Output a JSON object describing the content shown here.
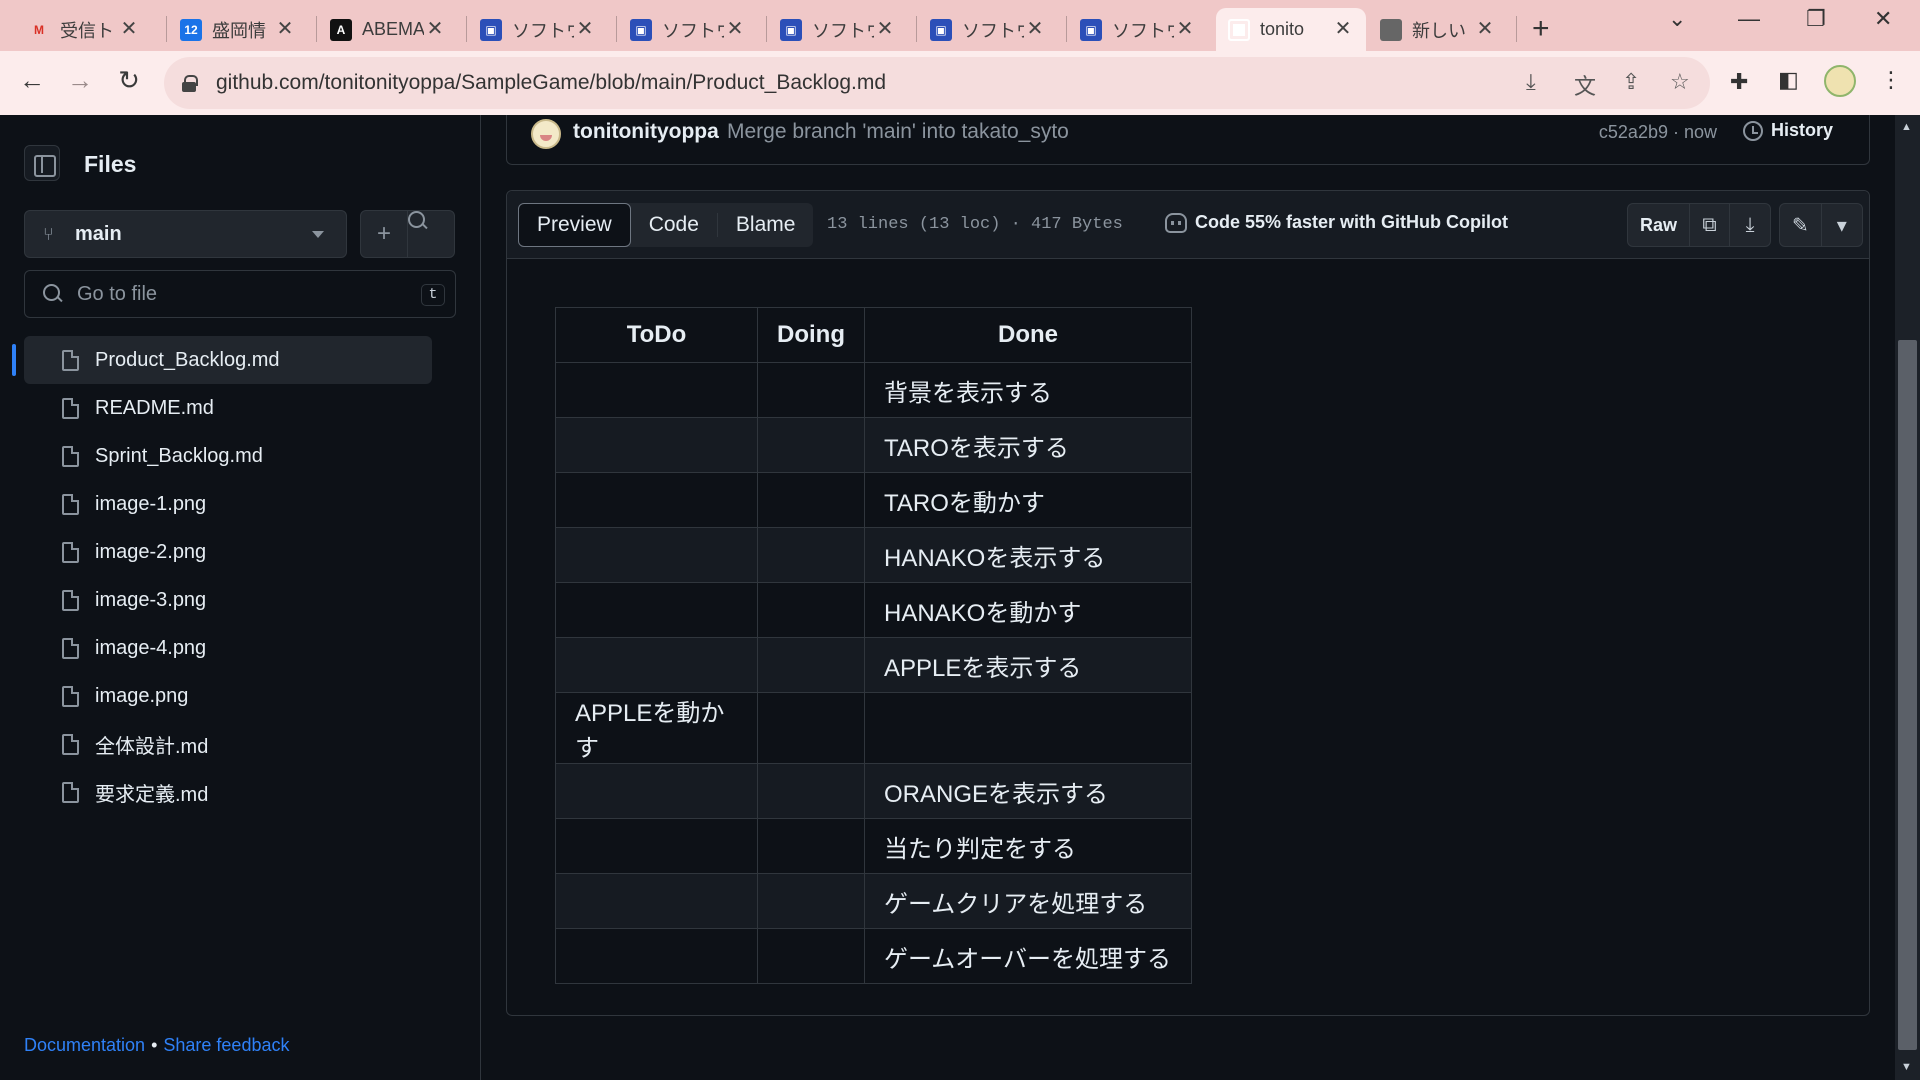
{
  "browser": {
    "tabs": [
      {
        "title": "受信ト",
        "favicon": "gmail-icon",
        "glyph": "M"
      },
      {
        "title": "盛岡情",
        "favicon": "calendar-icon",
        "glyph": "12"
      },
      {
        "title": "ABEMA",
        "favicon": "abema-icon",
        "glyph": "A"
      },
      {
        "title": "ソフトウ",
        "favicon": "app-icon",
        "glyph": "▣"
      },
      {
        "title": "ソフトウ",
        "favicon": "app-icon",
        "glyph": "▣"
      },
      {
        "title": "ソフトウ",
        "favicon": "app-icon",
        "glyph": "▣"
      },
      {
        "title": "ソフトウ",
        "favicon": "app-icon",
        "glyph": "▣"
      },
      {
        "title": "ソフトウ",
        "favicon": "app-icon",
        "glyph": "▣"
      },
      {
        "title": "tonito",
        "favicon": "github-icon",
        "glyph": ""
      },
      {
        "title": "新しい",
        "favicon": "chrome-icon",
        "glyph": ""
      }
    ],
    "close_glyph": "✕",
    "new_tab_glyph": "+",
    "url": "github.com/tonitonityoppa/SampleGame/blob/main/Product_Backlog.md"
  },
  "sidebar": {
    "title": "Files",
    "branch": "main",
    "add_glyph": "+",
    "search_glyph": "⌕",
    "go_to_file_placeholder": "Go to file",
    "shortcut_key": "t",
    "files": [
      "Product_Backlog.md",
      "README.md",
      "Sprint_Backlog.md",
      "image-1.png",
      "image-2.png",
      "image-3.png",
      "image-4.png",
      "image.png",
      "全体設計.md",
      "要求定義.md"
    ],
    "selected_file": "Product_Backlog.md",
    "footer": {
      "documentation": "Documentation",
      "separator": "•",
      "feedback": "Share feedback"
    }
  },
  "commit": {
    "author": "tonitonityoppa",
    "message": "Merge branch 'main' into takato_syto",
    "sha_time": "c52a2b9 · now",
    "history_label": "History"
  },
  "file_view": {
    "tabs": [
      "Preview",
      "Code",
      "Blame"
    ],
    "active_tab": "Preview",
    "meta": "13 lines (13 loc) · 417 Bytes",
    "copilot_label": "Code 55% faster with GitHub Copilot",
    "raw_label": "Raw",
    "copy_glyph": "⧉",
    "download_glyph": "⤓",
    "edit_glyph": "✎",
    "more_glyph": "▾"
  },
  "table": {
    "headers": [
      "ToDo",
      "Doing",
      "Done"
    ],
    "rows": [
      [
        "",
        "",
        "背景を表示する"
      ],
      [
        "",
        "",
        "TAROを表示する"
      ],
      [
        "",
        "",
        "TAROを動かす"
      ],
      [
        "",
        "",
        "HANAKOを表示する"
      ],
      [
        "",
        "",
        "HANAKOを動かす"
      ],
      [
        "",
        "",
        "APPLEを表示する"
      ],
      [
        "APPLEを動かす",
        "",
        ""
      ],
      [
        "",
        "",
        "ORANGEを表示する"
      ],
      [
        "",
        "",
        "当たり判定をする"
      ],
      [
        "",
        "",
        "ゲームクリアを処理する"
      ],
      [
        "",
        "",
        "ゲームオーバーを処理する"
      ]
    ]
  },
  "colors": {
    "accent": "#2f81f7",
    "background": "#0d1117",
    "border": "#30363d",
    "tabstrip": "#f0c8c8"
  }
}
